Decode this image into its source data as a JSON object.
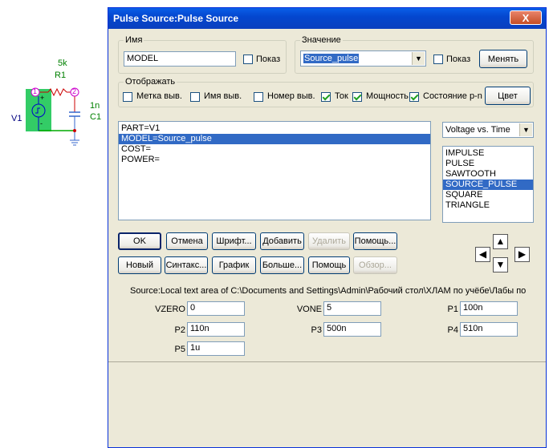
{
  "schematic": {
    "resistor_value": "5k",
    "resistor_name": "R1",
    "capacitor_value": "1n",
    "capacitor_name": "C1",
    "source_name": "V1",
    "node1": "1",
    "node2": "2",
    "plus": "+",
    "minus": "-"
  },
  "dialog": {
    "title": "Pulse Source:Pulse Source",
    "close_label": "X",
    "name_group": {
      "label": "Имя",
      "value": "MODEL",
      "show_label": "Показ",
      "show_checked": false
    },
    "value_group": {
      "label": "Значение",
      "value": "Source_pulse",
      "show_label": "Показ",
      "show_checked": false,
      "change_button": "Менять"
    },
    "display_group": {
      "label": "Отображать",
      "items": [
        {
          "label": "Метка выв.",
          "checked": false
        },
        {
          "label": "Имя выв.",
          "checked": false
        },
        {
          "label": "Номер выв.",
          "checked": false
        },
        {
          "label": "Ток",
          "checked": true
        },
        {
          "label": "Мощность",
          "checked": true
        },
        {
          "label": "Состояние p-n",
          "checked": true
        }
      ],
      "color_button": "Цвет"
    },
    "attributes": [
      {
        "text": "PART=V1",
        "selected": false
      },
      {
        "text": "MODEL=Source_pulse",
        "selected": true
      },
      {
        "text": "COST=",
        "selected": false
      },
      {
        "text": "POWER=",
        "selected": false
      }
    ],
    "plot_select": "Voltage vs. Time",
    "models": [
      {
        "text": "IMPULSE",
        "selected": false
      },
      {
        "text": "PULSE",
        "selected": false
      },
      {
        "text": "SAWTOOTH",
        "selected": false
      },
      {
        "text": "SOURCE_PULSE",
        "selected": true
      },
      {
        "text": "SQUARE",
        "selected": false
      },
      {
        "text": "TRIANGLE",
        "selected": false
      }
    ],
    "buttons_row1": [
      {
        "label": "OK",
        "disabled": false
      },
      {
        "label": "Отмена",
        "disabled": false
      },
      {
        "label": "Шрифт...",
        "disabled": false
      },
      {
        "label": "Добавить",
        "disabled": false
      },
      {
        "label": "Удалить",
        "disabled": true
      },
      {
        "label": "Помощь...",
        "disabled": false
      }
    ],
    "buttons_row2": [
      {
        "label": "Новый",
        "disabled": false
      },
      {
        "label": "Синтакс...",
        "disabled": false
      },
      {
        "label": "График",
        "disabled": false
      },
      {
        "label": "Больше...",
        "disabled": false
      },
      {
        "label": "Помощь",
        "disabled": false
      },
      {
        "label": "Обзор...",
        "disabled": true
      }
    ],
    "nav_arrows": {
      "up": "▲",
      "down": "▼",
      "left": "◀",
      "right": "▶"
    },
    "source_path": "Source:Local text area of C:\\Documents and Settings\\Admin\\Рабочий стол\\ХЛАМ по учёбе\\Лабы по",
    "params": [
      {
        "name": "VZERO",
        "value": "0"
      },
      {
        "name": "VONE",
        "value": "5"
      },
      {
        "name": "P1",
        "value": "100n"
      },
      {
        "name": "P2",
        "value": "110n"
      },
      {
        "name": "P3",
        "value": "500n"
      },
      {
        "name": "P4",
        "value": "510n"
      },
      {
        "name": "P5",
        "value": "1u"
      }
    ]
  }
}
